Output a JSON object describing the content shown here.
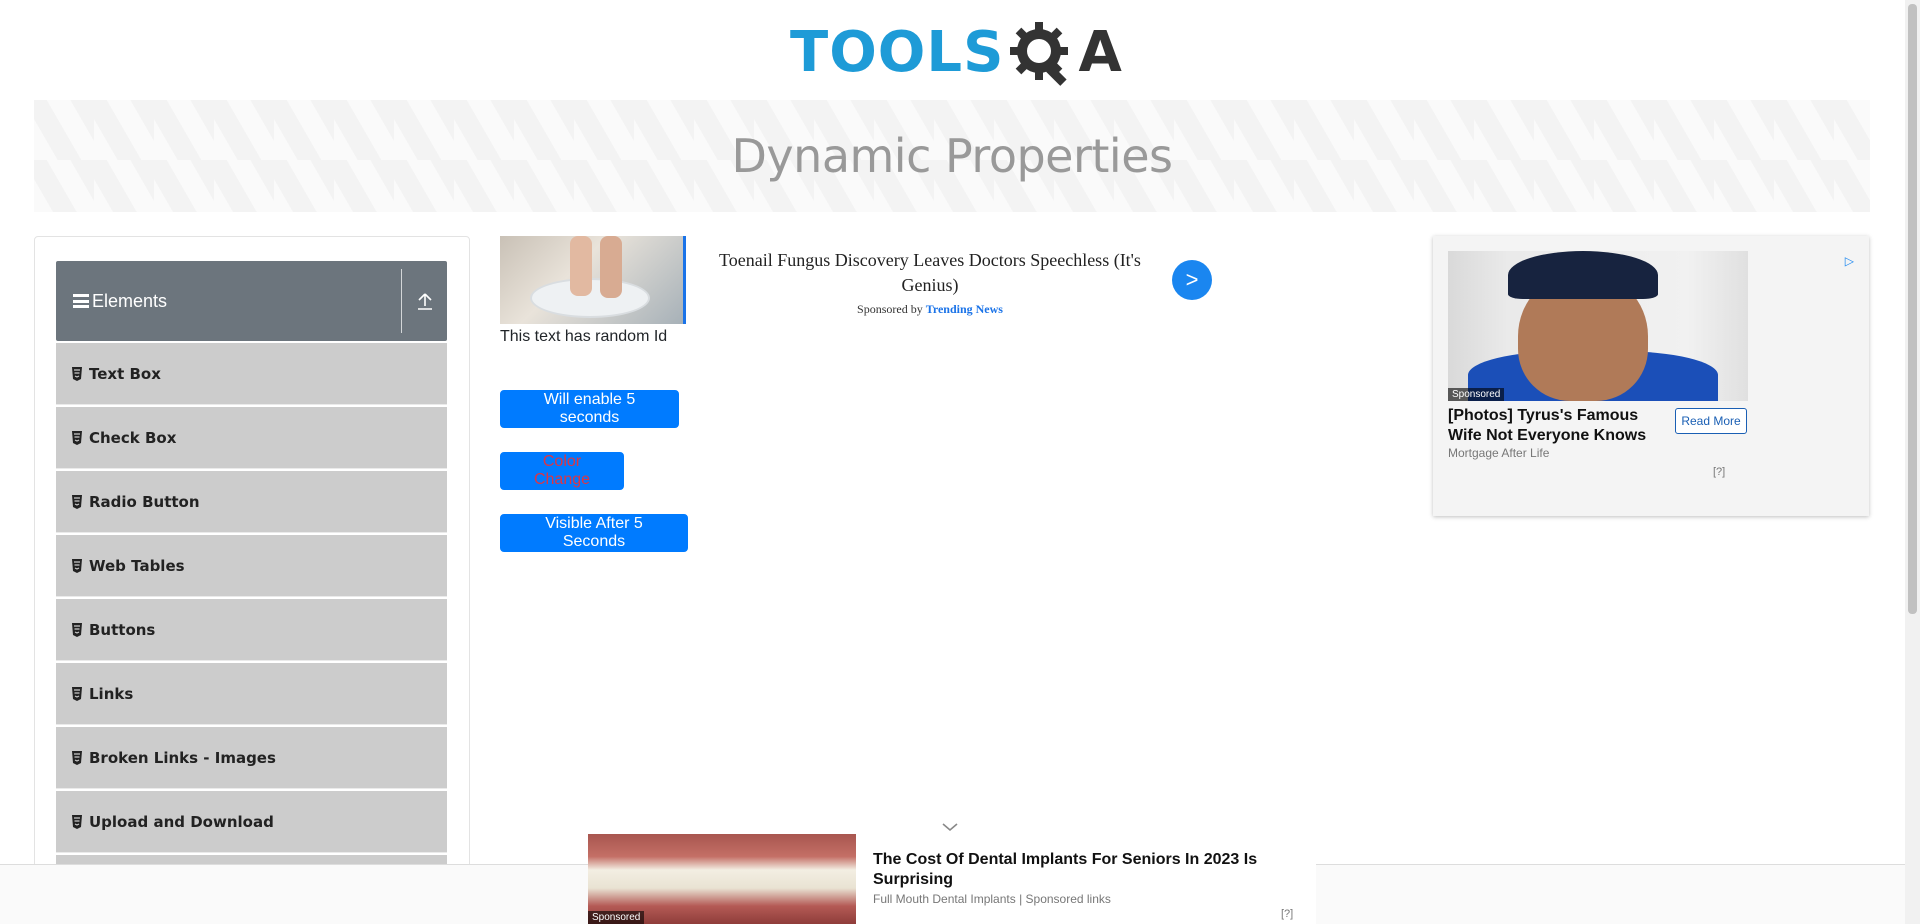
{
  "logo": {
    "text": "TOOLS",
    "suffix": "A",
    "brand_color": "#1e9bd7"
  },
  "banner": {
    "title": "Dynamic Properties"
  },
  "sidebar": {
    "group_title": "Elements",
    "items": [
      {
        "label": "Text Box"
      },
      {
        "label": "Check Box"
      },
      {
        "label": "Radio Button"
      },
      {
        "label": "Web Tables"
      },
      {
        "label": "Buttons"
      },
      {
        "label": "Links"
      },
      {
        "label": "Broken Links - Images"
      },
      {
        "label": "Upload and Download"
      }
    ]
  },
  "main": {
    "random_text": "This text has random Id",
    "enable_button": "Will enable 5 seconds",
    "color_button": "Color Change",
    "visible_button": "Visible After 5 Seconds",
    "accent_color": "#007bff",
    "color_change_text_color": "#dc3545"
  },
  "ads": {
    "top": {
      "headline": "Toenail Fungus Discovery Leaves Doctors Speechless (It's Genius)",
      "sponsored_prefix": "Sponsored by ",
      "sponsor": "Trending News",
      "arrow": ">"
    },
    "right": {
      "tag": "Sponsored",
      "headline": "[Photos] Tyrus's Famous Wife Not Everyone Knows",
      "cta": "Read More",
      "source": "Mortgage After Life",
      "qmark": "[?]"
    },
    "bottom": {
      "tag": "Sponsored",
      "headline": "The Cost Of Dental Implants For Seniors In 2023 Is Surprising",
      "source": "Full Mouth Dental Implants | Sponsored links",
      "qmark": "[?]"
    }
  }
}
